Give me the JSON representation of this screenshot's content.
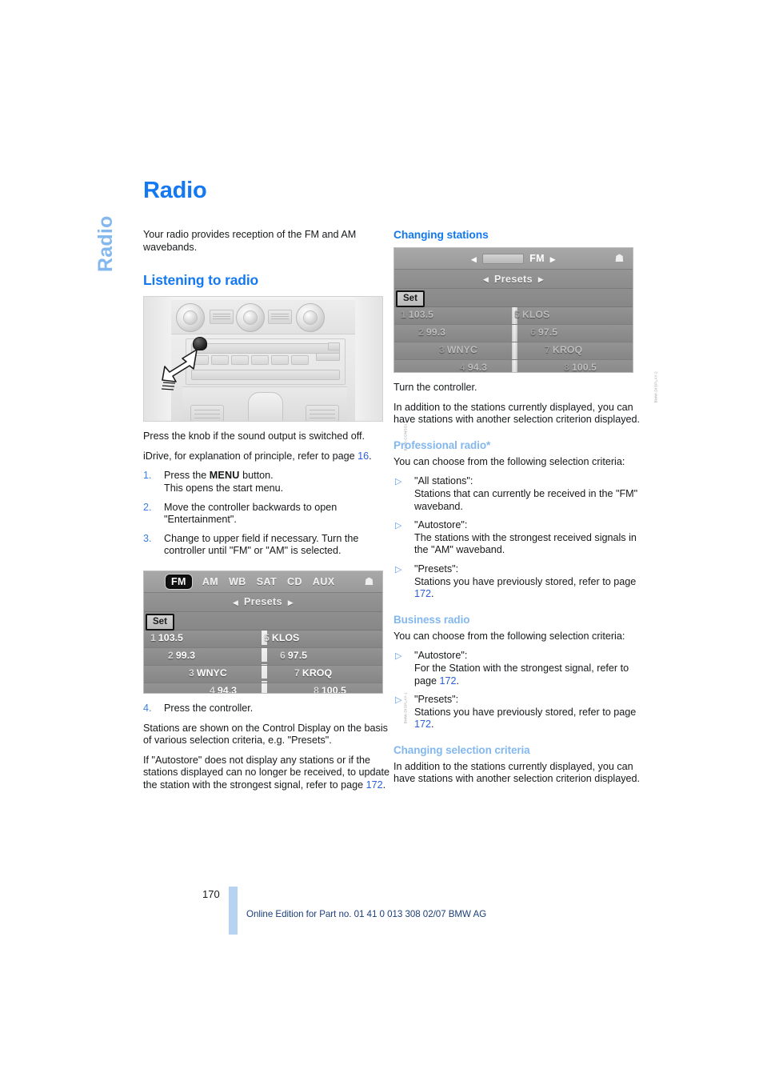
{
  "running_head": "Radio",
  "chapter_title": "Radio",
  "left_column": {
    "intro": "Your radio provides reception of the FM and AM wavebands.",
    "heading_listening": "Listening to radio",
    "figure_dashboard": {
      "name": "dashboard-photo",
      "caption_code": "BMW-CONSOLE"
    },
    "after_figure_1": "Press the knob if the sound output is switched off.",
    "after_figure_2_pre": "iDrive, for explanation of principle, refer to page ",
    "after_figure_2_link": "16",
    "after_figure_2_post": ".",
    "steps": [
      {
        "num": "1.",
        "pre": "Press the ",
        "kbd": "MENU",
        "post": " button.",
        "extra": "This opens the start menu."
      },
      {
        "num": "2.",
        "pre": "Move the controller backwards to open \"Entertainment\".",
        "kbd": "",
        "post": "",
        "extra": ""
      },
      {
        "num": "3.",
        "pre": "Change to upper field if necessary. Turn the controller until \"FM\" or \"AM\" is selected.",
        "kbd": "",
        "post": "",
        "extra": ""
      }
    ],
    "figure_display_1": {
      "name": "idrive-display-tabs",
      "caption_code": "BMW-DISPLAY-1"
    },
    "step4": {
      "num": "4.",
      "text": "Press the controller."
    },
    "para_stations": "Stations are shown on the Control Display on the basis of various selection criteria, e.g. \"Presets\".",
    "para_autostore_pre": "If \"Autostore\" does not display any stations or if the stations displayed can no longer be received, to update the station with the strongest signal, refer to page ",
    "para_autostore_link": "172",
    "para_autostore_post": "."
  },
  "right_column": {
    "heading_changing_stations": "Changing stations",
    "figure_display_2": {
      "name": "idrive-display-fm",
      "caption_code": "BMW-DISPLAY-2"
    },
    "turn_controller": "Turn the controller.",
    "in_addition_1": "In addition to the stations currently displayed, you can have stations with another selection criterion displayed.",
    "heading_professional": "Professional radio*",
    "choose_criteria_1": "You can choose from the following selection criteria:",
    "professional_items": [
      {
        "title": "\"All stations\":",
        "body": "Stations that can currently be received in the \"FM\" waveband.",
        "link": "",
        "body_post": ""
      },
      {
        "title": "\"Autostore\":",
        "body": "The stations with the strongest received signals in the \"AM\" waveband.",
        "link": "",
        "body_post": ""
      },
      {
        "title": "\"Presets\":",
        "body": "Stations you have previously stored, refer to page ",
        "link": "172",
        "body_post": "."
      }
    ],
    "heading_business": "Business radio",
    "choose_criteria_2": "You can choose from the following selection criteria:",
    "business_items": [
      {
        "title": "\"Autostore\":",
        "body": "For the Station with the strongest signal, refer to page ",
        "link": "172",
        "body_post": "."
      },
      {
        "title": "\"Presets\":",
        "body": "Stations you have previously stored, refer to page ",
        "link": "172",
        "body_post": "."
      }
    ],
    "heading_changing_criteria": "Changing selection criteria",
    "in_addition_2": "In addition to the stations currently displayed, you can have stations with another selection criterion displayed."
  },
  "idrive_display_1": {
    "tabs": [
      "FM",
      "AM",
      "WB",
      "SAT",
      "CD",
      "AUX"
    ],
    "selected_tab": "FM",
    "home_icon": "home-icon",
    "presets_label": "Presets",
    "arrow_left": "◂",
    "arrow_right": "▸",
    "set_button": "Set",
    "presets": [
      {
        "index": "1",
        "value": "103.5",
        "index_r": "5",
        "value_r": "KLOS"
      },
      {
        "index": "2",
        "value": "99.3",
        "index_r": "6",
        "value_r": "97.5"
      },
      {
        "index": "3",
        "value": "WNYC",
        "index_r": "7",
        "value_r": "KROQ"
      },
      {
        "index": "4",
        "value": "94.3",
        "index_r": "8",
        "value_r": "100.5"
      }
    ]
  },
  "idrive_display_2": {
    "band_label": "FM",
    "home_icon": "home-icon",
    "presets_label": "Presets",
    "arrow_left": "◂",
    "arrow_right": "▸",
    "set_button": "Set",
    "presets": [
      {
        "index": "1",
        "value": "103.5",
        "index_r": "5",
        "value_r": "KLOS"
      },
      {
        "index": "2",
        "value": "99.3",
        "index_r": "6",
        "value_r": "97.5"
      },
      {
        "index": "3",
        "value": "WNYC",
        "index_r": "7",
        "value_r": "KROQ"
      },
      {
        "index": "4",
        "value": "94.3",
        "index_r": "8",
        "value_r": "100.5"
      }
    ]
  },
  "footer": {
    "page_number": "170",
    "edition_line": "Online Edition for Part no. 01 41 0 013 308 02/07 BMW AG"
  },
  "colors": {
    "heading_strong": "#1478f0",
    "heading_light": "#83b8ee",
    "link": "#2b5fd9",
    "footer_bar": "#b6d4f2",
    "footer_text": "#1b3f7a"
  }
}
